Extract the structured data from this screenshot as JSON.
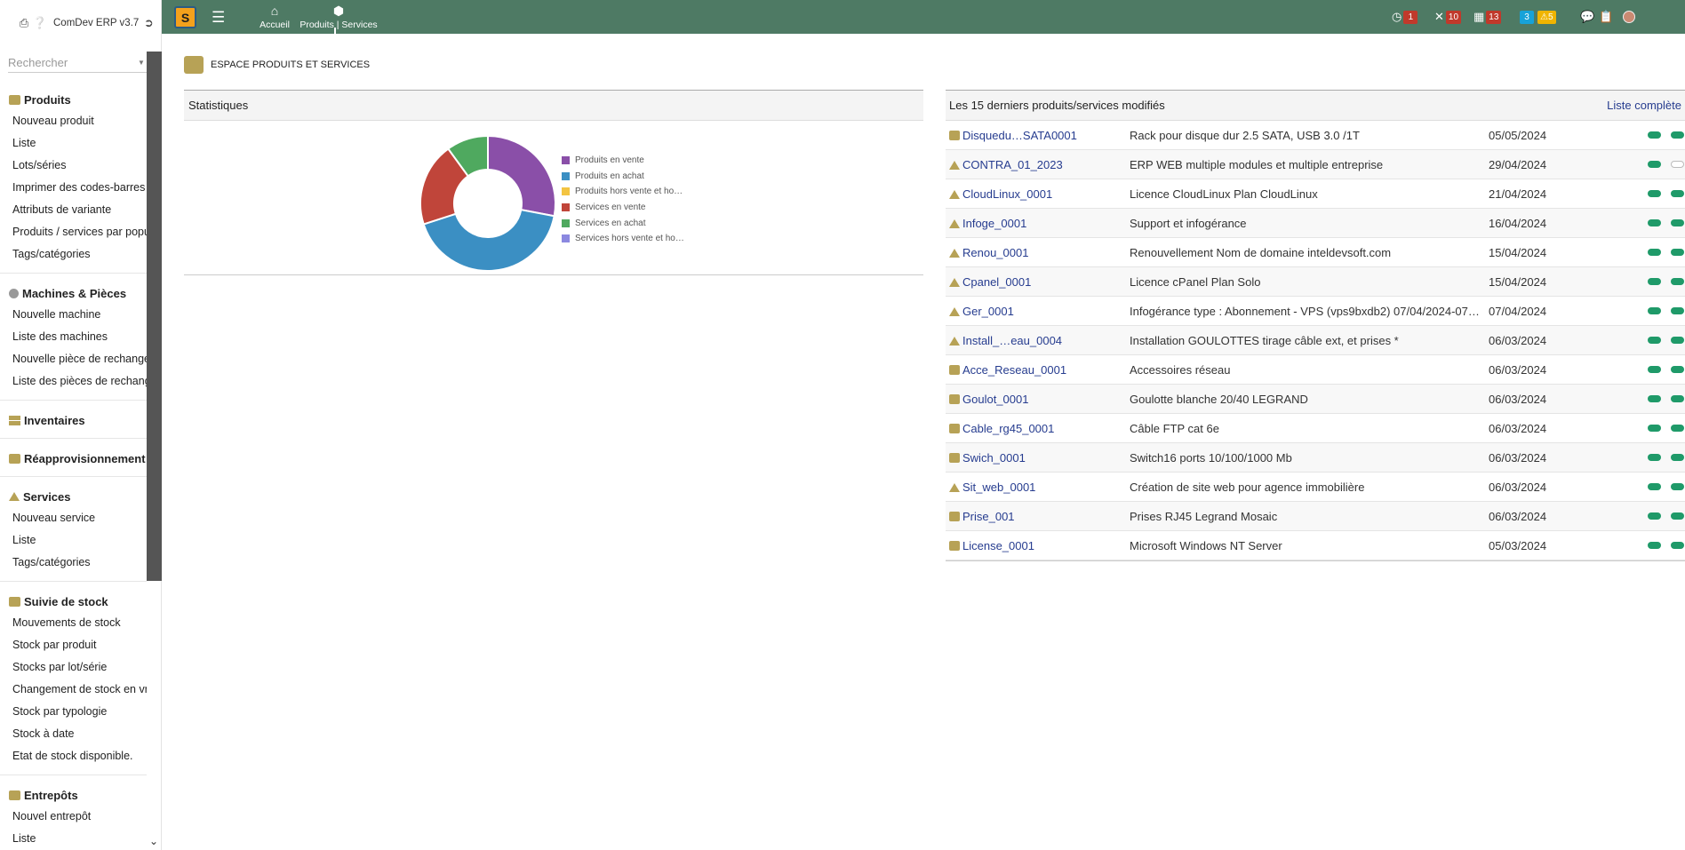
{
  "app": {
    "name": "ComDev ERP v3.7"
  },
  "search": {
    "placeholder": "Rechercher"
  },
  "menu": [
    {
      "title": "Produits",
      "icon": "box",
      "items": [
        "Nouveau produit",
        "Liste",
        "Lots/séries",
        "Imprimer des codes-barres",
        "Attributs de variante",
        "Produits / services par popu",
        "Tags/catégories"
      ]
    },
    {
      "title": "Machines & Pièces",
      "icon": "gear",
      "items": [
        "Nouvelle machine",
        "Liste des machines",
        "Nouvelle pièce de rechange",
        "Liste des pièces de rechang"
      ]
    },
    {
      "title": "Inventaires",
      "icon": "stack",
      "items": []
    },
    {
      "title": "Réapprovisionnement",
      "icon": "box",
      "items": []
    },
    {
      "title": "Services",
      "icon": "tri",
      "items": [
        "Nouveau service",
        "Liste",
        "Tags/catégories"
      ]
    },
    {
      "title": "Suivie de stock",
      "icon": "box",
      "items": [
        "Mouvements de stock",
        "Stock par produit",
        "Stocks par lot/série",
        "Changement de stock en vr",
        "Stock par typologie",
        "Stock à date",
        "Etat de stock disponible."
      ]
    },
    {
      "title": "Entrepôts",
      "icon": "box",
      "items": [
        "Nouvel entrepôt",
        "Liste",
        "Tags/catégories"
      ]
    }
  ],
  "topbar": {
    "logo_text": "S",
    "nav": [
      {
        "label": "Accueil",
        "icon": "home-icon"
      },
      {
        "label": "Produits | Services",
        "icon": "cube-icon"
      }
    ],
    "badges": {
      "agenda": "1",
      "tools": "10",
      "calendar": "13",
      "info": "3",
      "warning": "5"
    }
  },
  "page": {
    "title": "ESPACE PRODUITS ET SERVICES"
  },
  "stats": {
    "header": "Statistiques"
  },
  "chart_data": {
    "type": "pie",
    "categories": [
      "Produits en vente",
      "Produits en achat",
      "Produits hors vente et ho…",
      "Services en vente",
      "Services en achat",
      "Services hors vente et ho…"
    ],
    "values": [
      28,
      42,
      0,
      20,
      10,
      0
    ],
    "colors": [
      "#8a4fa8",
      "#3b8fc3",
      "#f3c442",
      "#c0453a",
      "#4fa95f",
      "#8b88e0"
    ],
    "donut": true,
    "legend_position": "right"
  },
  "latest": {
    "header": "Les 15 derniers produits/services modifiés",
    "full_list_link": "Liste complète",
    "rows": [
      {
        "ref": "Disquedu…SATA0001",
        "type": "product",
        "label": "Rack pour disque dur 2.5 SATA, USB 3.0 /1T",
        "date": "05/05/2024",
        "sell": true,
        "buy": true
      },
      {
        "ref": "CONTRA_01_2023",
        "type": "service",
        "label": "ERP WEB multiple modules et multiple entreprise",
        "date": "29/04/2024",
        "sell": true,
        "buy": false
      },
      {
        "ref": "CloudLinux_0001",
        "type": "service",
        "label": "Licence CloudLinux Plan CloudLinux",
        "date": "21/04/2024",
        "sell": true,
        "buy": true
      },
      {
        "ref": "Infoge_0001",
        "type": "service",
        "label": "Support et infogérance",
        "date": "16/04/2024",
        "sell": true,
        "buy": true
      },
      {
        "ref": "Renou_0001",
        "type": "service",
        "label": "Renouvellement Nom de domaine inteldevsoft.com",
        "date": "15/04/2024",
        "sell": true,
        "buy": true
      },
      {
        "ref": "Cpanel_0001",
        "type": "service",
        "label": "Licence cPanel Plan Solo",
        "date": "15/04/2024",
        "sell": true,
        "buy": true
      },
      {
        "ref": "Ger_0001",
        "type": "service",
        "label": "Infogérance type : Abonnement - VPS (vps9bxdb2) 07/04/2024-07…",
        "date": "07/04/2024",
        "sell": true,
        "buy": true
      },
      {
        "ref": "Install_…eau_0004",
        "type": "service",
        "label": "Installation GOULOTTES tirage câble ext, et prises *",
        "date": "06/03/2024",
        "sell": true,
        "buy": true
      },
      {
        "ref": "Acce_Reseau_0001",
        "type": "product",
        "label": "Accessoires réseau",
        "date": "06/03/2024",
        "sell": true,
        "buy": true
      },
      {
        "ref": "Goulot_0001",
        "type": "product",
        "label": "Goulotte blanche 20/40 LEGRAND",
        "date": "06/03/2024",
        "sell": true,
        "buy": true
      },
      {
        "ref": "Cable_rg45_0001",
        "type": "product",
        "label": "Câble FTP cat 6e",
        "date": "06/03/2024",
        "sell": true,
        "buy": true
      },
      {
        "ref": "Swich_0001",
        "type": "product",
        "label": "Switch16 ports 10/100/1000 Mb",
        "date": "06/03/2024",
        "sell": true,
        "buy": true
      },
      {
        "ref": "Sit_web_0001",
        "type": "service",
        "label": "Création de site web pour agence immobilière",
        "date": "06/03/2024",
        "sell": true,
        "buy": true
      },
      {
        "ref": "Prise_001",
        "type": "product",
        "label": "Prises RJ45 Legrand Mosaic",
        "date": "06/03/2024",
        "sell": true,
        "buy": true
      },
      {
        "ref": "License_0001",
        "type": "product",
        "label": "Microsoft Windows NT Server",
        "date": "05/03/2024",
        "sell": true,
        "buy": true
      }
    ]
  }
}
